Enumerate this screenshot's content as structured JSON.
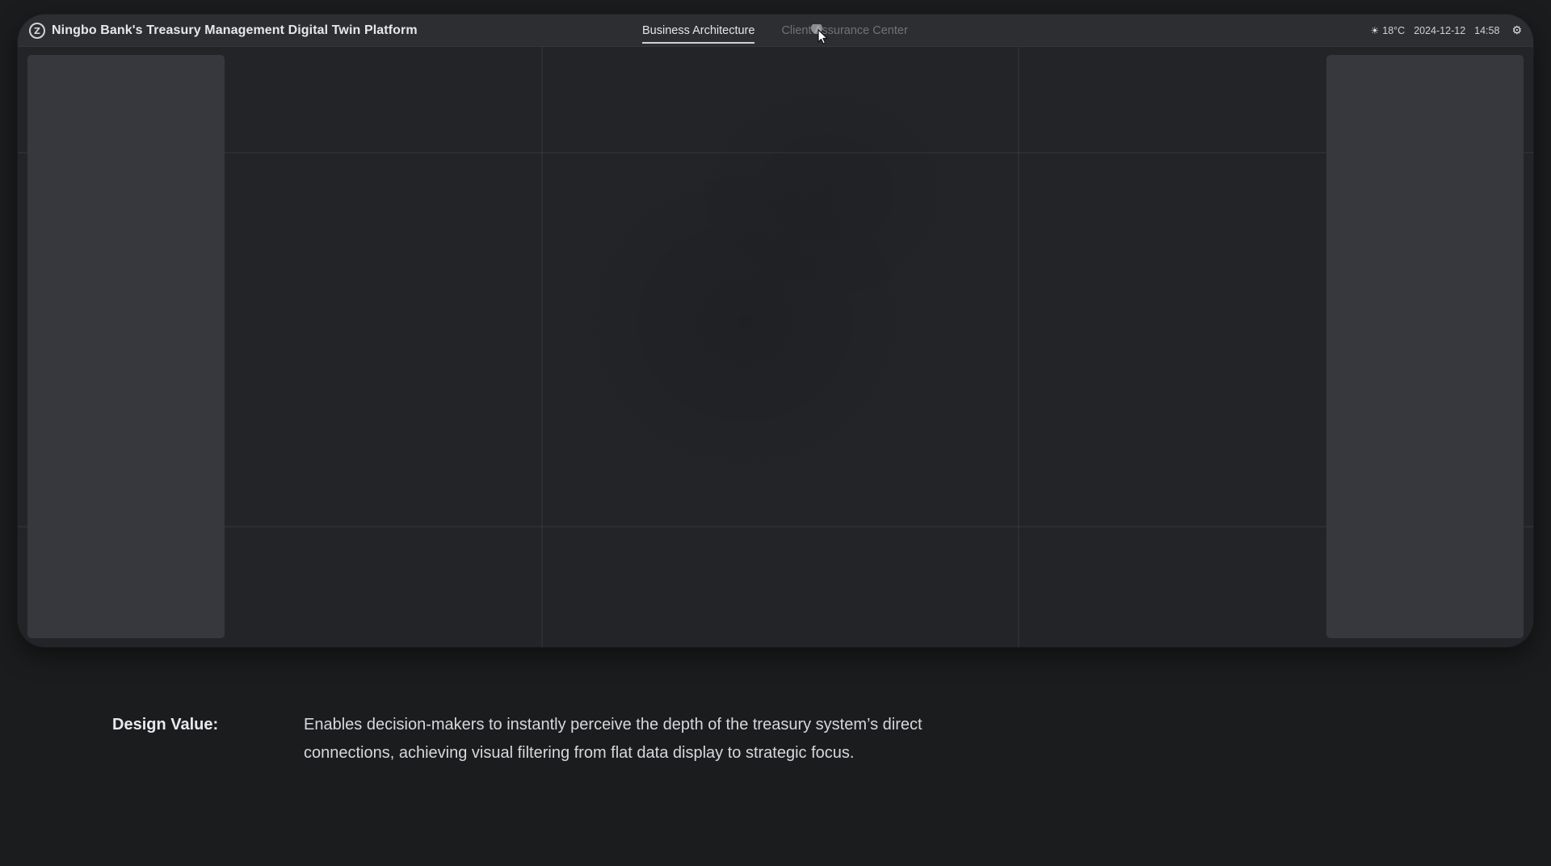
{
  "header": {
    "logo_glyph": "⦿",
    "title": "Ningbo Bank's Treasury Management Digital Twin Platform"
  },
  "tabs": [
    {
      "label": "Business Architecture",
      "active": true
    },
    {
      "label": "Client Assurance Center",
      "active": false
    }
  ],
  "status": {
    "weather_icon": "☀",
    "temperature": "18°C",
    "date": "2024-12-12",
    "time": "14:58",
    "settings_icon": "⚙"
  },
  "caption": {
    "label": "Design Value:",
    "text": "Enables decision-makers to instantly perceive the depth of the treasury system’s direct connections, achieving visual filtering from flat data display to strategic focus."
  },
  "colors": {
    "page_background": "#1b1c1d",
    "topbar": "#2c2e32",
    "map_background": "#222428",
    "side_panel": "#36383d"
  }
}
